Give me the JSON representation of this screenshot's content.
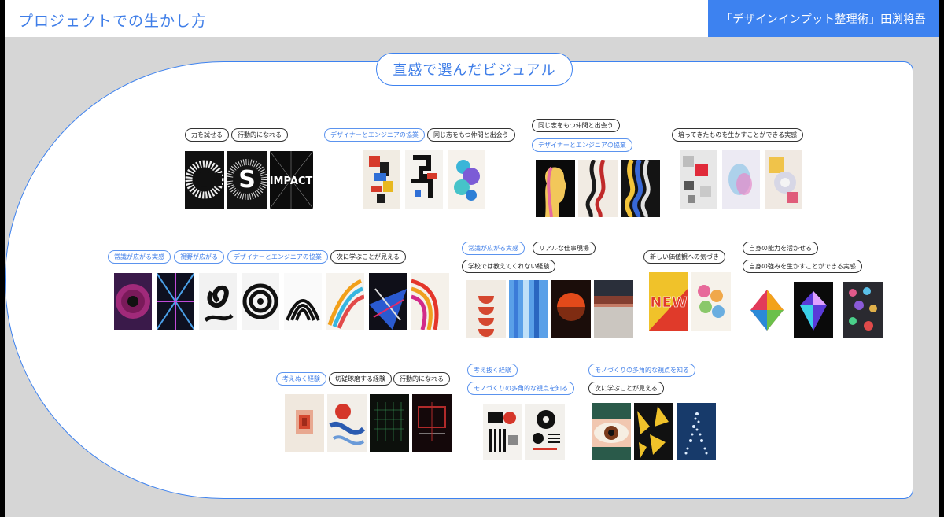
{
  "header": {
    "title": "プロジェクトでの生かし方",
    "credit": "「デザインインプット整理術」田渕将吾"
  },
  "section": {
    "title": "直感で選んだビジュアル"
  },
  "groups": [
    {
      "tags": [
        {
          "text": "力を試せる"
        },
        {
          "text": "行動的になれる"
        }
      ]
    },
    {
      "tags": [
        {
          "text": "デザイナーとエンジニアの協業"
        },
        {
          "text": "同じ志をもつ仲間と出会う"
        }
      ]
    },
    {
      "tags": [
        {
          "text": "同じ志をもつ仲間と出会う"
        },
        {
          "text": "デザイナーとエンジニアの協業"
        }
      ]
    },
    {
      "tags": [
        {
          "text": "培ってきたものを生かすことができる実感"
        }
      ]
    },
    {
      "tags": [
        {
          "text": "常識が広がる実感"
        },
        {
          "text": "視野が広がる"
        },
        {
          "text": "デザイナーとエンジニアの協業"
        },
        {
          "text": "次に学ぶことが見える"
        }
      ]
    },
    {
      "tags": [
        {
          "text": "常識が広がる実感"
        },
        {
          "text": "リアルな仕事現場"
        },
        {
          "text": "学校では教えてくれない経験"
        }
      ]
    },
    {
      "tags": [
        {
          "text": "新しい価値観への気づき"
        }
      ]
    },
    {
      "tags": [
        {
          "text": "自身の能力を活かせる"
        },
        {
          "text": "自身の強みを生かすことができる実感"
        }
      ]
    },
    {
      "tags": [
        {
          "text": "考えぬく経験"
        },
        {
          "text": "切磋琢磨する経験"
        },
        {
          "text": "行動的になれる"
        }
      ]
    },
    {
      "tags": [
        {
          "text": "考え抜く経験"
        },
        {
          "text": "モノづくりの多角的な視点を知る"
        }
      ]
    },
    {
      "tags": [
        {
          "text": "モノづくりの多角的な視点を知る"
        },
        {
          "text": "次に学ぶことが見える"
        }
      ]
    }
  ],
  "posters": {
    "impact_text": "IMPACT",
    "s_text": "S",
    "new_text": "NEW"
  },
  "colors": {
    "accent": "#3d82f0",
    "background": "#d6d6d6"
  }
}
